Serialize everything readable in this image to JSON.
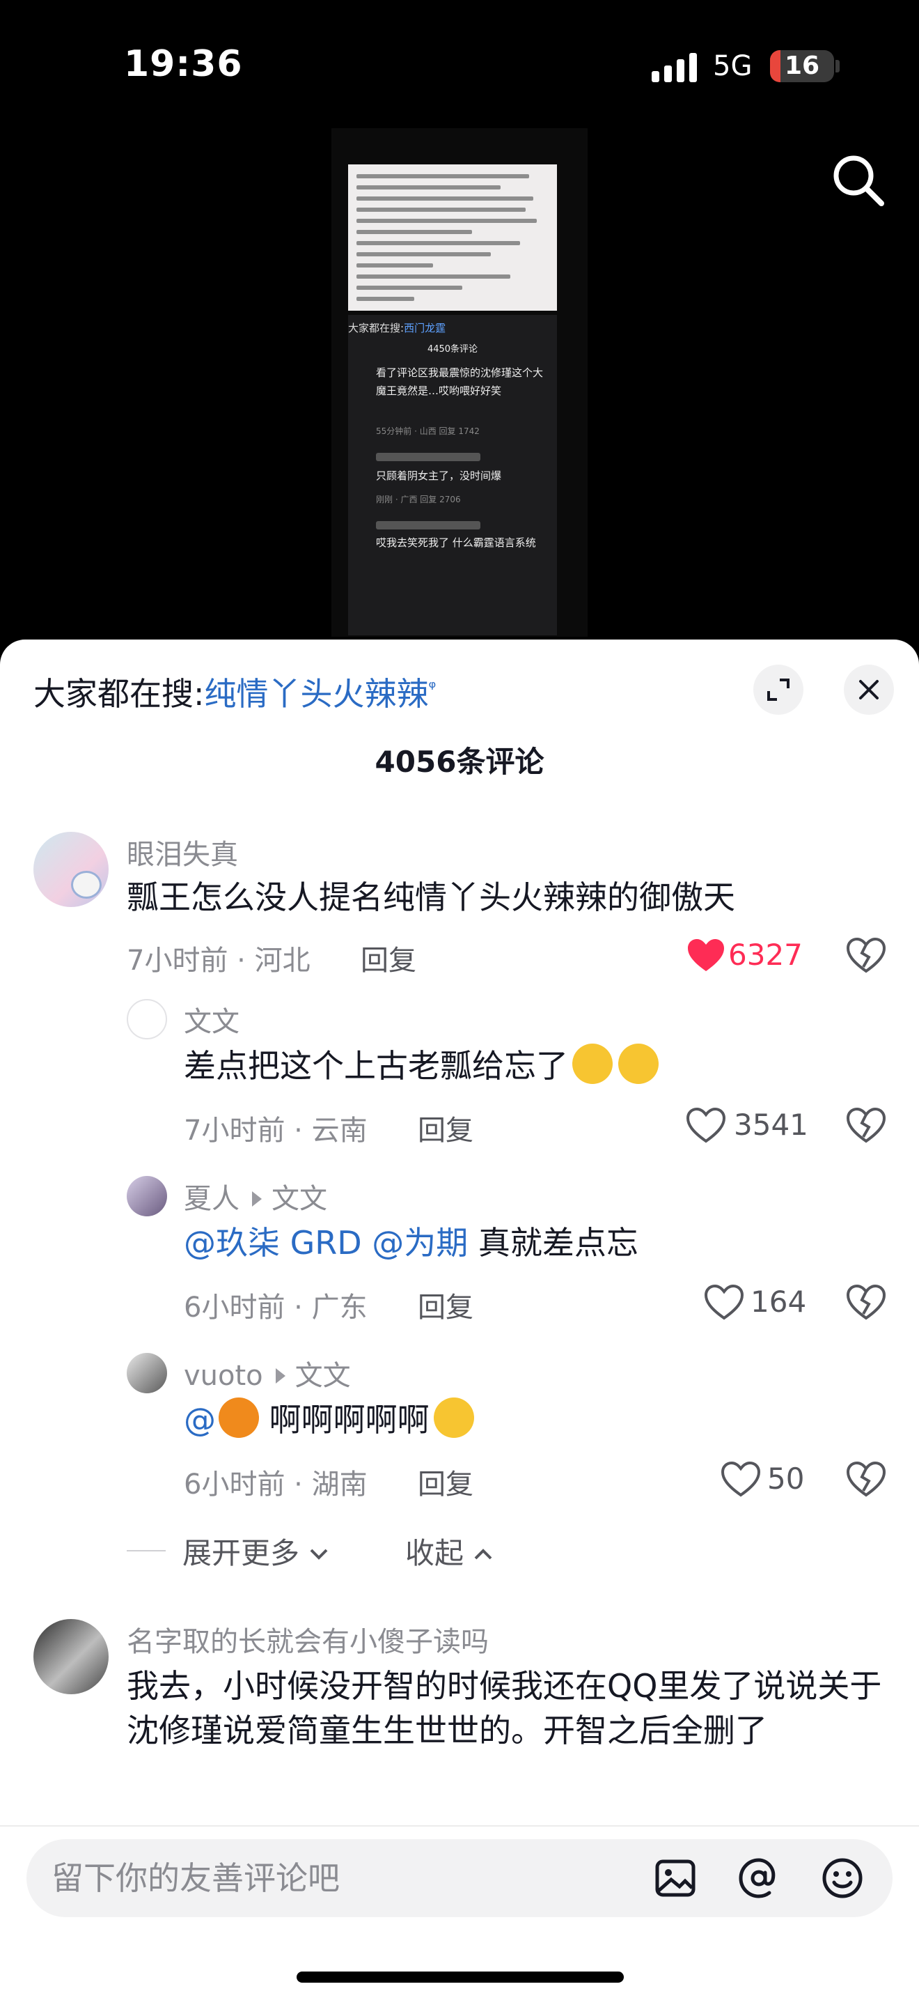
{
  "status_bar": {
    "time": "19:36",
    "network": "5G",
    "battery": "16",
    "battery_level": 0.16
  },
  "video": {
    "doc_lines": 12,
    "search_label": "大家都在搜:",
    "search_keyword": "西门龙霆",
    "comment_count": "4450条评论",
    "comments": [
      {
        "text": "看了评论区我最震惊的沈修瑾这个大魔王竟然是…哎哟喂好好笑",
        "meta": "55分钟前 · 山西   回复   1742"
      },
      {
        "text": "只顾着阴女主了，没时间爆",
        "meta": "刚刚 · 广西   回复   2706"
      },
      {
        "text": "哎我去笑死我了 什么霸霆语言系统",
        "meta": ""
      }
    ]
  },
  "sheet": {
    "search_label": "大家都在搜:",
    "search_keyword": "纯情丫头火辣辣",
    "title": "4056条评论",
    "comments": [
      {
        "name": "眼泪失真",
        "text": "瓢王怎么没人提名纯情丫头火辣辣的御傲天",
        "meta": "7小时前 · 河北",
        "reply": "回复",
        "likes": "6327",
        "liked": true
      },
      {
        "name": "文文",
        "text": "差点把这个上古老瓢给忘了",
        "meta": "7小时前 · 云南",
        "reply": "回复",
        "likes": "3541"
      },
      {
        "name": "夏人",
        "reply_to": "文文",
        "mentions": "@玖柒 GRD @为期",
        "text": " 真就差点忘",
        "meta": "6小时前 · 广东",
        "reply": "回复",
        "likes": "164"
      },
      {
        "name": "vuoto",
        "reply_to": "文文",
        "mention": "@",
        "text": " 啊啊啊啊啊",
        "meta": "6小时前 · 湖南",
        "reply": "回复",
        "likes": "50"
      },
      {
        "name": "名字取的长就会有小傻子读吗",
        "text": "我去，小时候没开智的时候我还在QQ里发了说说关于沈修瑾说爱简童生生世世的。开智之后全删了"
      }
    ],
    "expand_label": "展开更多",
    "collapse_label": "收起"
  },
  "input": {
    "placeholder": "留下你的友善评论吧"
  },
  "colors": {
    "accent": "#fe2c55",
    "link": "#2a6bc4",
    "battery_low": "#e8463c"
  },
  "icons": [
    "search-icon",
    "expand-icon",
    "close-icon",
    "heart-icon",
    "dislike-icon",
    "image-icon",
    "at-icon",
    "emoji-icon"
  ]
}
